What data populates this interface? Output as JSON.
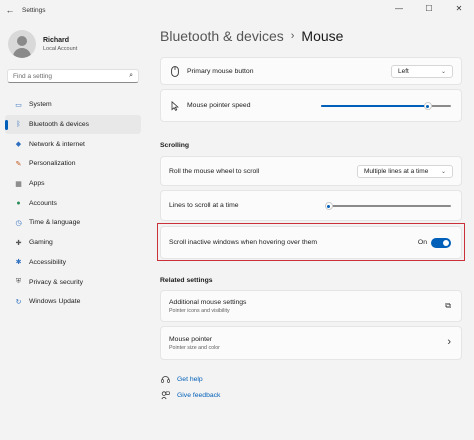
{
  "window": {
    "title": "Settings",
    "controls": {
      "minimize": "—",
      "maximize": "☐",
      "close": "✕"
    }
  },
  "profile": {
    "name": "Richard",
    "account": "Local Account"
  },
  "search": {
    "placeholder": "Find a setting"
  },
  "nav": [
    {
      "label": "System",
      "icon": "monitor-icon",
      "glyph": "▭"
    },
    {
      "label": "Bluetooth & devices",
      "icon": "bluetooth-icon",
      "glyph": "ᛒ",
      "active": true
    },
    {
      "label": "Network & internet",
      "icon": "wifi-icon",
      "glyph": "◆"
    },
    {
      "label": "Personalization",
      "icon": "brush-icon",
      "glyph": "✎"
    },
    {
      "label": "Apps",
      "icon": "apps-icon",
      "glyph": "▦"
    },
    {
      "label": "Accounts",
      "icon": "person-icon",
      "glyph": "●"
    },
    {
      "label": "Time & language",
      "icon": "globe-clock-icon",
      "glyph": "◷"
    },
    {
      "label": "Gaming",
      "icon": "gamepad-icon",
      "glyph": "✚"
    },
    {
      "label": "Accessibility",
      "icon": "accessibility-icon",
      "glyph": "✱"
    },
    {
      "label": "Privacy & security",
      "icon": "shield-icon",
      "glyph": "⛨"
    },
    {
      "label": "Windows Update",
      "icon": "update-icon",
      "glyph": "↻"
    }
  ],
  "breadcrumb": {
    "parent": "Bluetooth & devices",
    "separator": "›",
    "current": "Mouse"
  },
  "primary_button": {
    "label": "Primary mouse button",
    "value": "Left",
    "chevron": "⌄"
  },
  "pointer_speed": {
    "label": "Mouse pointer speed",
    "level": 0.82
  },
  "scrolling": {
    "heading": "Scrolling",
    "roll": {
      "label": "Roll the mouse wheel to scroll",
      "value": "Multiple lines at a time",
      "chevron": "⌄"
    },
    "lines": {
      "label": "Lines to scroll at a time",
      "level": 0.03
    },
    "inactive": {
      "label": "Scroll inactive windows when hovering over them",
      "state": "On",
      "on": true
    }
  },
  "related": {
    "heading": "Related settings",
    "items": [
      {
        "title": "Additional mouse settings",
        "subtitle": "Pointer icons and visibility",
        "action_icon": "open-external-icon",
        "glyph": "⧉"
      },
      {
        "title": "Mouse pointer",
        "subtitle": "Pointer size and color",
        "action_icon": "chevron-right-icon",
        "glyph": "›"
      }
    ]
  },
  "help": {
    "get_help": "Get help",
    "feedback": "Give feedback"
  },
  "colors": {
    "accent": "#005fb8",
    "highlight_border": "#c8303a"
  }
}
